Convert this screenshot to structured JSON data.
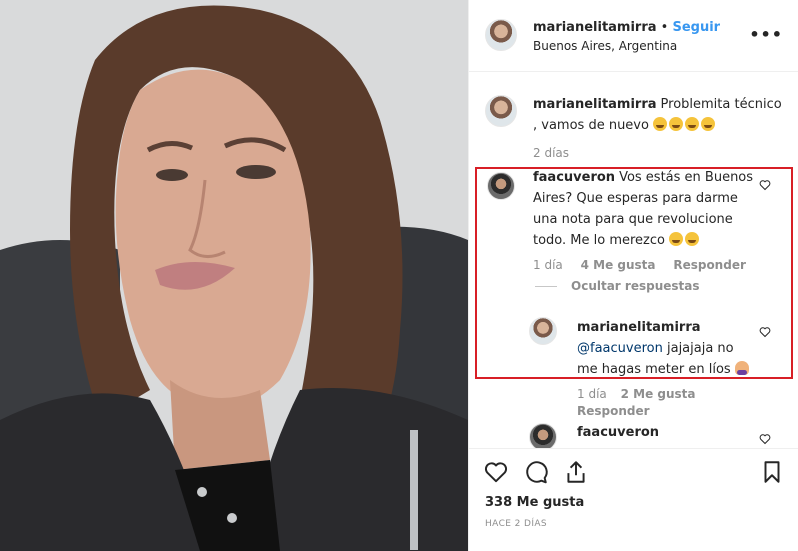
{
  "header": {
    "username": "marianelitamirra",
    "separator": "•",
    "follow_label": "Seguir",
    "location": "Buenos Aires, Argentina",
    "more_label": "•••"
  },
  "caption": {
    "username": "marianelitamirra",
    "text": "Problemita técnico , vamos de nuevo",
    "emoji": [
      "rolling-on-floor-laughing",
      "rolling-on-floor-laughing",
      "rolling-on-floor-laughing",
      "grinning-squinting"
    ],
    "time": "2 días"
  },
  "comment1": {
    "username": "faacuveron",
    "text": "Vos estás en Buenos Aires? Que esperas para darme una nota para que revolucione todo. Me lo merezco",
    "emoji": [
      "grinning-squinting",
      "grinning-squinting"
    ],
    "time": "1 día",
    "likes": "4 Me gusta",
    "reply_label": "Responder",
    "hide_replies_label": "Ocultar respuestas"
  },
  "reply1": {
    "username": "marianelitamirra",
    "mention": "@faacuveron",
    "text": "jajajaja no me hagas meter en líos",
    "emoji": [
      "person-gesturing-no"
    ],
    "time": "1 día",
    "likes": "2 Me gusta",
    "reply_label": "Responder"
  },
  "reply2": {
    "username": "faacuveron"
  },
  "footer": {
    "likes": "338 Me gusta",
    "posted": "HACE 2 DÍAS",
    "icons": [
      "heart-icon",
      "comment-icon",
      "share-icon",
      "bookmark-icon"
    ]
  },
  "colors": {
    "link": "#3897f0",
    "highlight_border": "#d81f26",
    "muted": "#8e8e8e"
  }
}
